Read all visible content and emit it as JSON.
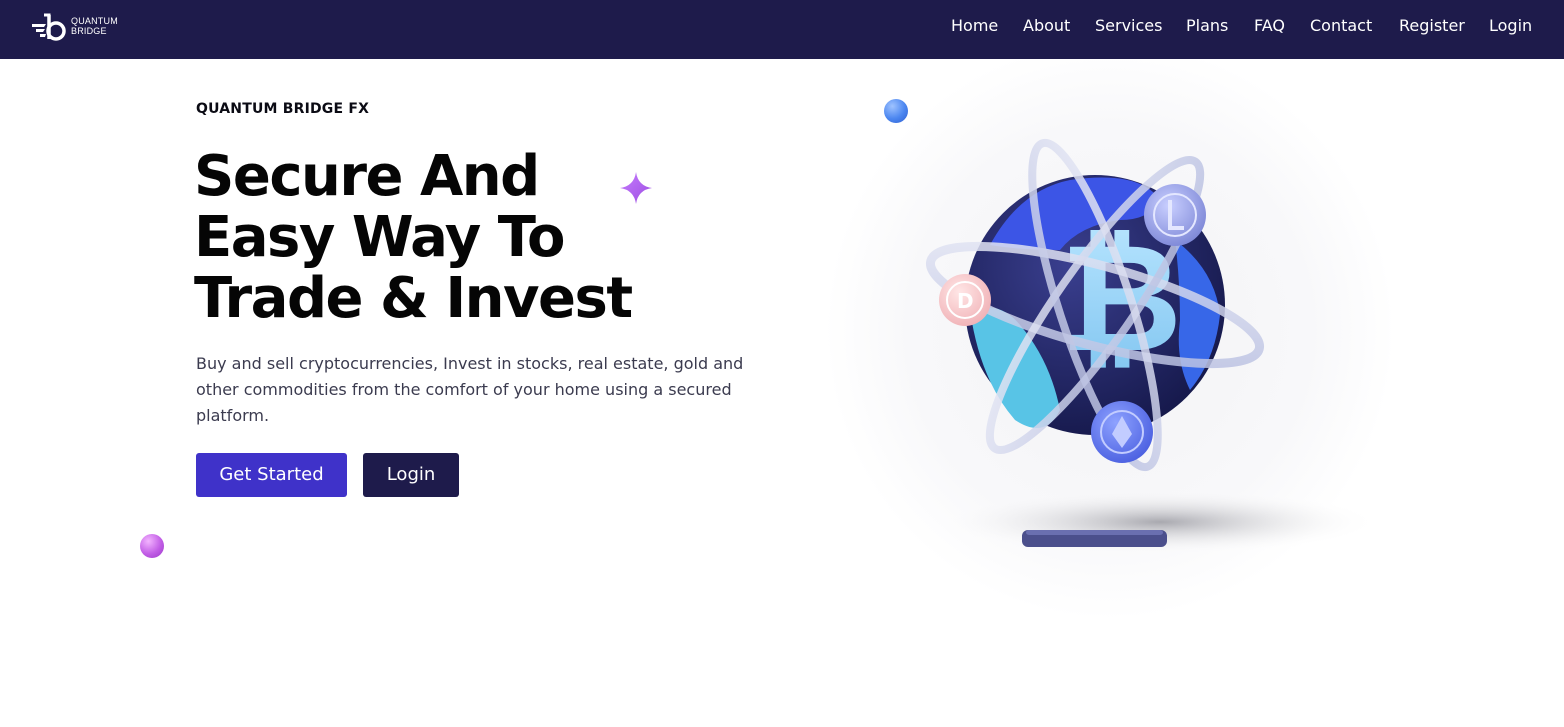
{
  "brand": {
    "logo_line1": "QUANTUM",
    "logo_line2": "BRIDGE"
  },
  "nav": {
    "items": [
      "Home",
      "About",
      "Services",
      "Plans",
      "FAQ",
      "Contact",
      "Register",
      "Login"
    ]
  },
  "hero": {
    "eyebrow": "QUANTUM BRIDGE FX",
    "headline_lines": [
      "Secure And",
      "Easy Way To",
      "Trade & Invest"
    ],
    "description": "Buy and sell cryptocurrencies, Invest in stocks, real estate, gold and other commodities from the comfort of your home using a secured platform.",
    "primary_button": "Get Started",
    "secondary_button": "Login"
  },
  "illustration": {
    "coin_left_letter": "D",
    "icons": [
      "bitcoin-icon",
      "litecoin-icon",
      "dogecoin-icon",
      "ethereum-icon"
    ]
  },
  "colors": {
    "navbar_bg": "#1e1b4b",
    "primary": "#3f32c9",
    "secondary": "#1e1b4b",
    "text_dark": "#050505"
  }
}
